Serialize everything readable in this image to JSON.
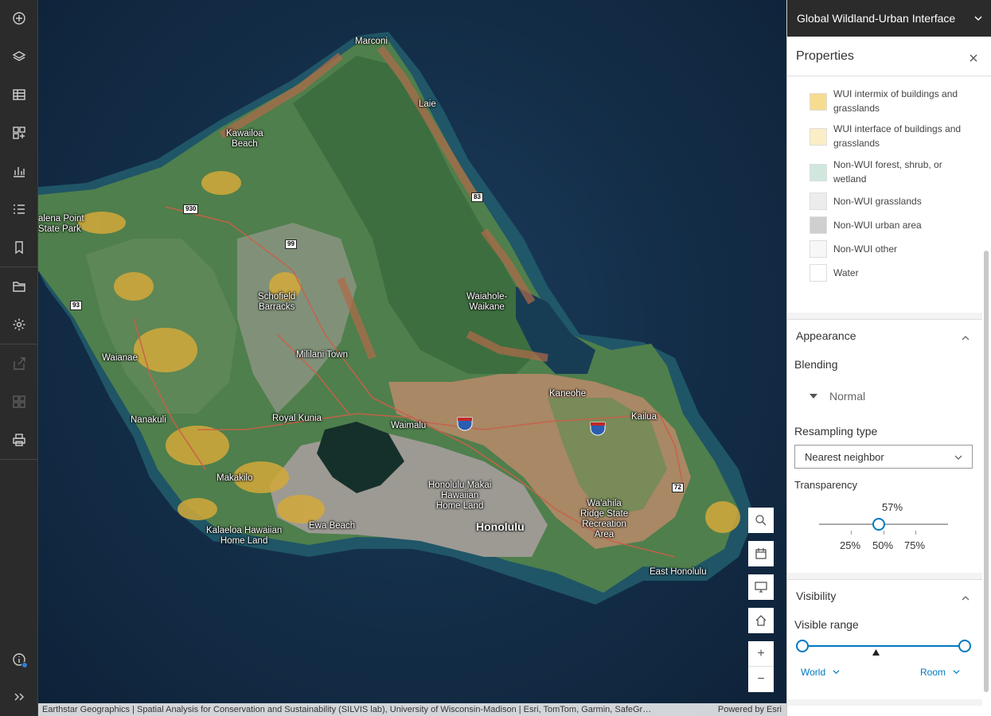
{
  "toolbar": {
    "items": [
      {
        "icon": "add-icon"
      },
      {
        "icon": "layers-icon"
      },
      {
        "icon": "table-icon"
      },
      {
        "icon": "widgets-icon"
      },
      {
        "icon": "chart-icon"
      },
      {
        "icon": "legend-icon"
      },
      {
        "icon": "bookmark-icon"
      },
      {
        "icon": "folder-icon"
      },
      {
        "icon": "settings-icon"
      },
      {
        "icon": "share-icon",
        "disabled": true
      },
      {
        "icon": "grid-icon",
        "disabled": true
      },
      {
        "icon": "print-icon"
      },
      {
        "icon": "info-icon"
      },
      {
        "icon": "expand-icon"
      }
    ]
  },
  "map": {
    "places": {
      "marconi": "Marconi",
      "laie": "Laie",
      "kawailoa": "Kawailoa\nBeach",
      "kaena": "alena Point\nState Park",
      "schofield": "Schofield\nBarracks",
      "waiahole": "Waiahole-\nWaikane",
      "waianae": "Waianae",
      "mililani": "Mililani Town",
      "kaneohe": "Kaneohe",
      "nanakuli": "Nanakuli",
      "royal_kunia": "Royal Kunia",
      "waimalu": "Waimalu",
      "kailua": "Kailua",
      "makakilo": "Makakilo",
      "honolulu_makai": "Honolulu Makai\nHawaiian\nHome Land",
      "honolulu": "Honolulu",
      "waahila": "Wa'ahila\nRidge State\nRecreation\nArea",
      "ewa": "Ewa Beach",
      "kalaeloa": "Kalaeloa Hawaiian\nHome Land",
      "east_honolulu": "East Honolulu"
    },
    "shields": {
      "r930": "930",
      "r99": "99",
      "r83": "83",
      "r93": "93",
      "r72": "72",
      "i3a": "3",
      "i3b": "3"
    },
    "attribution": "Earthstar Geographics | Spatial Analysis for Conservation and Sustainability (SILVIS lab), University of Wisconsin-Madison | Esri, TomTom, Garmin, SafeGr…",
    "powered_by": "Powered by Esri"
  },
  "panel": {
    "layer_title": "Global Wildland-Urban Interface",
    "properties_title": "Properties",
    "legend": [
      {
        "label": "WUI intermix of buildings and grasslands",
        "color": "#f6dc8f"
      },
      {
        "label": "WUI interface of buildings and grasslands",
        "color": "#fbeec6"
      },
      {
        "label": "Non-WUI forest, shrub, or wetland",
        "color": "#cfe7dc"
      },
      {
        "label": "Non-WUI grasslands",
        "color": "#ececec"
      },
      {
        "label": "Non-WUI urban area",
        "color": "#cfcfcf"
      },
      {
        "label": "Non-WUI other",
        "color": "#f7f7f7"
      },
      {
        "label": "Water",
        "color": "#ffffff"
      }
    ],
    "appearance": {
      "title": "Appearance",
      "blending_label": "Blending",
      "blending_value": "Normal",
      "resampling_label": "Resampling type",
      "resampling_value": "Nearest neighbor",
      "transparency_label": "Transparency",
      "transparency_value": "57%",
      "transparency_level": 57,
      "ticks": [
        "25%",
        "50%",
        "75%"
      ]
    },
    "visibility": {
      "title": "Visibility",
      "range_label": "Visible range",
      "min_label": "World",
      "max_label": "Room"
    }
  }
}
